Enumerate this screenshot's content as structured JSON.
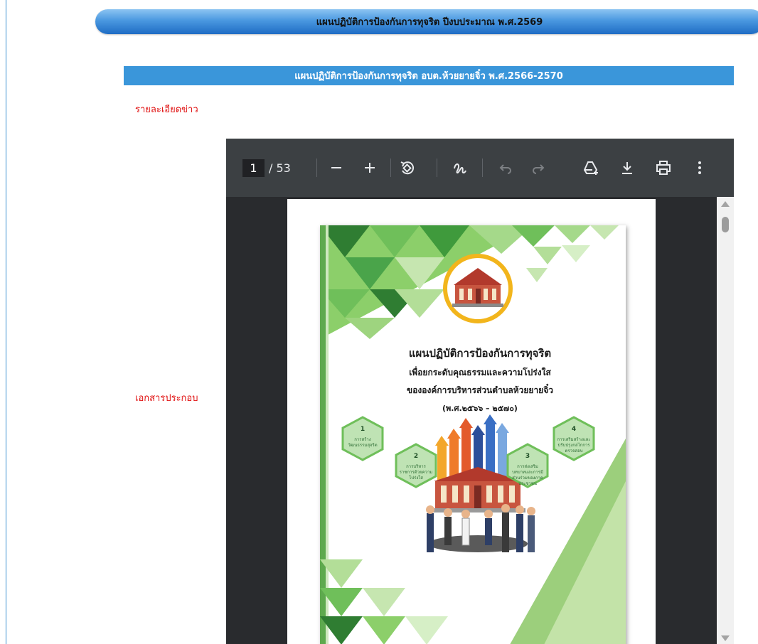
{
  "header": {
    "banner_title": "แผนปฏิบัติการป้องกันการทุจริต ปีงบประมาณ พ.ศ.2569",
    "sub_banner_title": "แผนปฏิบัติการป้องกันการทุจริต อบต.ห้วยยายจิ๋ว พ.ศ.2566-2570"
  },
  "labels": {
    "news_detail": "รายละเอียดข่าว",
    "attachments": "เอกสารประกอบ"
  },
  "pdf_viewer": {
    "current_page": "1",
    "page_total": "/ 53",
    "icons": [
      "minus-icon",
      "plus-icon",
      "rotate-icon",
      "annotate-icon",
      "undo-icon",
      "redo-icon",
      "drive-add-icon",
      "download-icon",
      "print-icon",
      "more-icon"
    ],
    "cover": {
      "title": "แผนปฏิบัติการป้องกันการทุจริต",
      "line2": "เพื่อยกระดับคุณธรรมและความโปร่งใส",
      "line3": "ขององค์การบริหารส่วนตำบลห้วยยายจิ๋ว",
      "line4": "(พ.ศ.๒๕๖๖ – ๒๕๗๐)",
      "hex_1_num": "1",
      "hex_1_text": "การสร้างวัฒนธรรมสุจริต",
      "hex_2_num": "2",
      "hex_2_text": "การบริหารราชการด้วยความโปร่งใส",
      "hex_3_num": "3",
      "hex_3_text": "การส่งเสริมบทบาทและการมีส่วนร่วมของภาคประชาชน",
      "hex_4_num": "4",
      "hex_4_text": "การเสริมสร้างและปรับปรุงกลไกการตรวจสอบ"
    }
  },
  "colors": {
    "banner_blue": "#4a98e0",
    "sub_banner_blue": "#3a96da",
    "label_red": "#e01010",
    "viewer_dark": "#3c4043",
    "cover_green": "#6fbf5a"
  }
}
